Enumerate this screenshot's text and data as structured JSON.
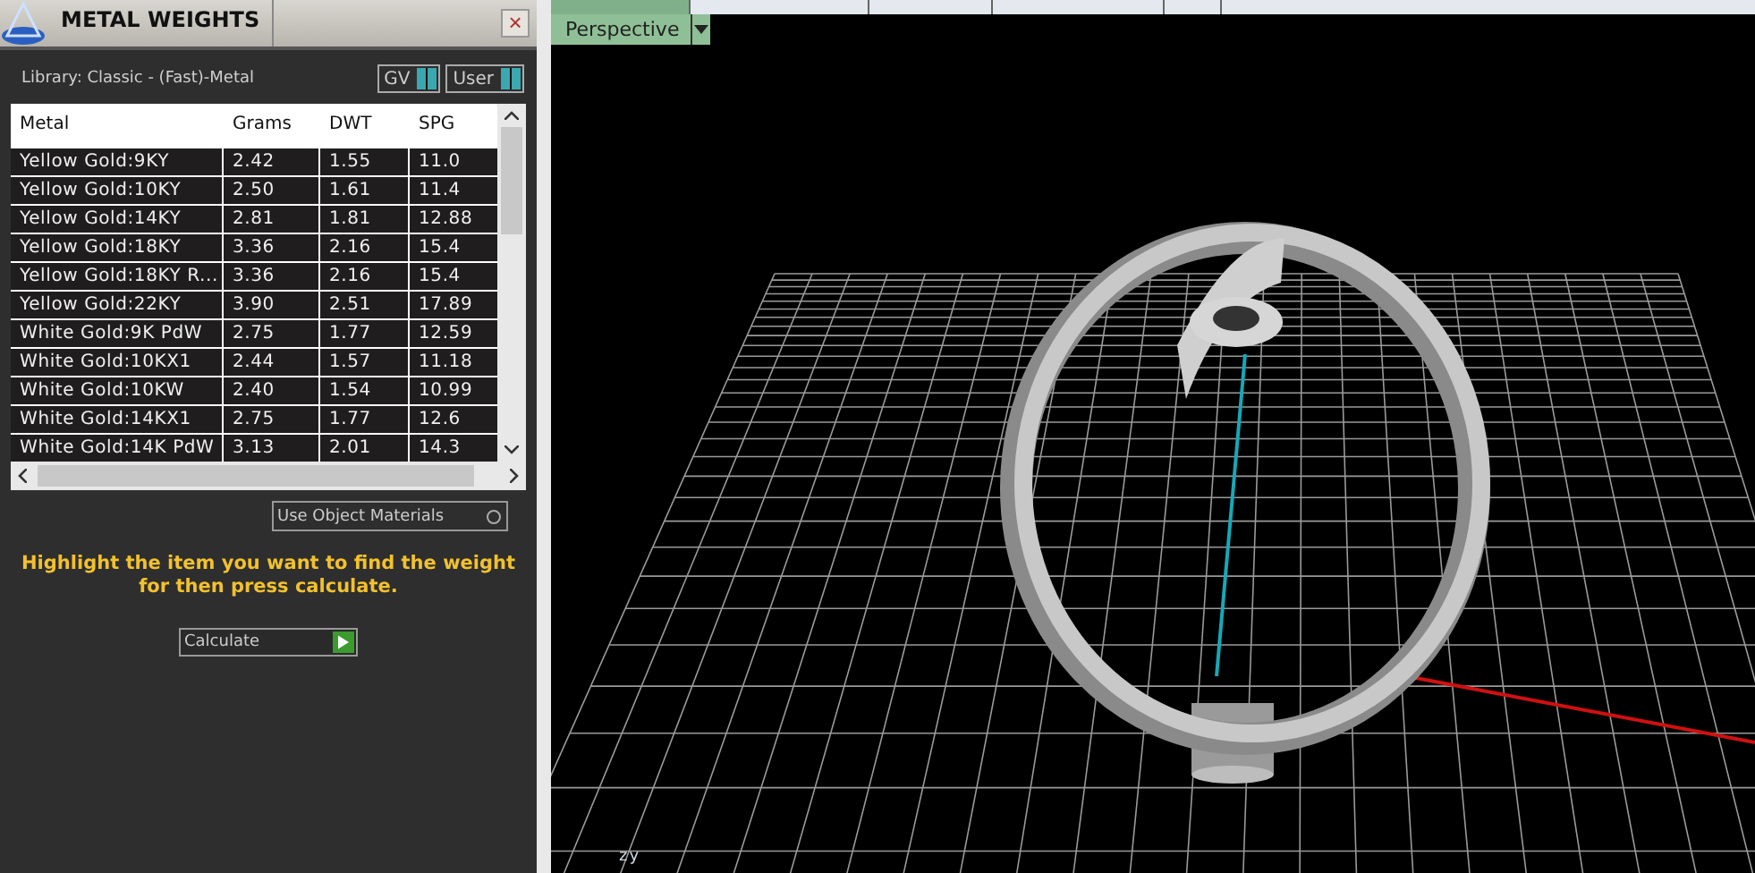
{
  "panel": {
    "title": "METAL WEIGHTS",
    "close": "×",
    "library": "Library: Classic - (Fast)-Metal",
    "toggles": [
      {
        "label": "GV",
        "on": true
      },
      {
        "label": "User",
        "on": true
      }
    ]
  },
  "table": {
    "columns": [
      "Metal",
      "Grams",
      "DWT",
      "SPG"
    ],
    "rows": [
      [
        "Yellow Gold:9KY",
        "2.42",
        "1.55",
        "11.0"
      ],
      [
        "Yellow Gold:10KY",
        "2.50",
        "1.61",
        "11.4"
      ],
      [
        "Yellow Gold:14KY",
        "2.81",
        "1.81",
        "12.88"
      ],
      [
        "Yellow Gold:18KY",
        "3.36",
        "2.16",
        "15.4"
      ],
      [
        "Yellow Gold:18KY R...",
        "3.36",
        "2.16",
        "15.4"
      ],
      [
        "Yellow Gold:22KY",
        "3.90",
        "2.51",
        "17.89"
      ],
      [
        "White Gold:9K PdW",
        "2.75",
        "1.77",
        "12.59"
      ],
      [
        "White Gold:10KX1",
        "2.44",
        "1.57",
        "11.18"
      ],
      [
        "White Gold:10KW",
        "2.40",
        "1.54",
        "10.99"
      ],
      [
        "White Gold:14KX1",
        "2.75",
        "1.77",
        "12.6"
      ],
      [
        "White Gold:14K PdW",
        "3.13",
        "2.01",
        "14.3"
      ]
    ]
  },
  "use_object_materials": {
    "label": "Use Object Materials",
    "checked": false
  },
  "hint": "Highlight the item you want to find the weight for then press calculate.",
  "calculate": "Calculate",
  "viewport": {
    "view": "Perspective",
    "axis_labels": [
      "z",
      "y"
    ]
  }
}
